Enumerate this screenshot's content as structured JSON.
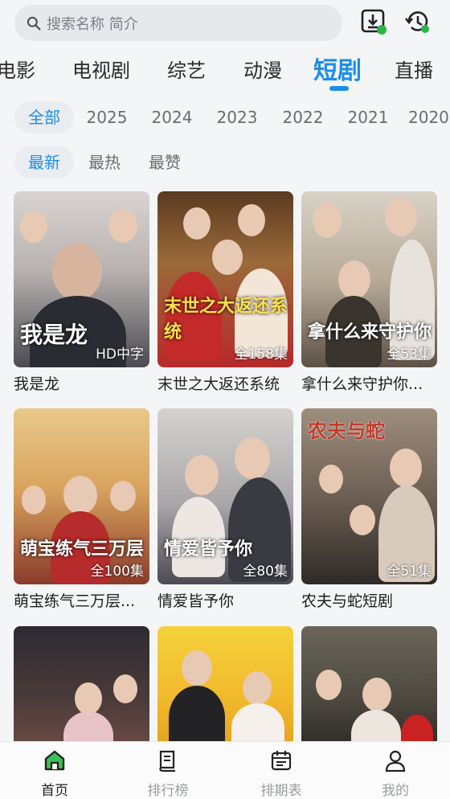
{
  "search": {
    "placeholder": "搜索名称 简介"
  },
  "categories": [
    {
      "label": "电影"
    },
    {
      "label": "电视剧"
    },
    {
      "label": "综艺"
    },
    {
      "label": "动漫"
    },
    {
      "label": "短剧"
    },
    {
      "label": "直播"
    }
  ],
  "active_category": "短剧",
  "years": [
    {
      "label": "全部"
    },
    {
      "label": "2025"
    },
    {
      "label": "2024"
    },
    {
      "label": "2023"
    },
    {
      "label": "2022"
    },
    {
      "label": "2021"
    },
    {
      "label": "2020"
    }
  ],
  "sorts": [
    {
      "label": "最新"
    },
    {
      "label": "最热"
    },
    {
      "label": "最赞"
    }
  ],
  "items": [
    {
      "title": "我是龙",
      "badge": "HD中字",
      "poster_text": "我是龙"
    },
    {
      "title": "末世之大返还系统",
      "badge": "全158集",
      "poster_text": "末世之大返还系统"
    },
    {
      "title": "拿什么来守护你...",
      "badge": "全53集",
      "poster_text": "拿什么来守护你"
    },
    {
      "title": "萌宝练气三万层...",
      "badge": "全100集",
      "poster_text": "萌宝练气三万层"
    },
    {
      "title": "情爱皆予你",
      "badge": "全80集",
      "poster_text": "情爱皆予你"
    },
    {
      "title": "农夫与蛇短剧",
      "badge": "全51集",
      "poster_text": "农夫与蛇"
    },
    {
      "title": "",
      "badge": "",
      "poster_text": ""
    },
    {
      "title": "",
      "badge": "",
      "poster_text": ""
    },
    {
      "title": "",
      "badge": "",
      "poster_text": ""
    }
  ],
  "nav": [
    {
      "label": "首页",
      "icon": "home-icon"
    },
    {
      "label": "排行榜",
      "icon": "ranking-icon"
    },
    {
      "label": "排期表",
      "icon": "calendar-icon"
    },
    {
      "label": "我的",
      "icon": "profile-icon"
    }
  ],
  "colors": {
    "accent": "#1b8fe6",
    "download": "#2ab54a"
  }
}
